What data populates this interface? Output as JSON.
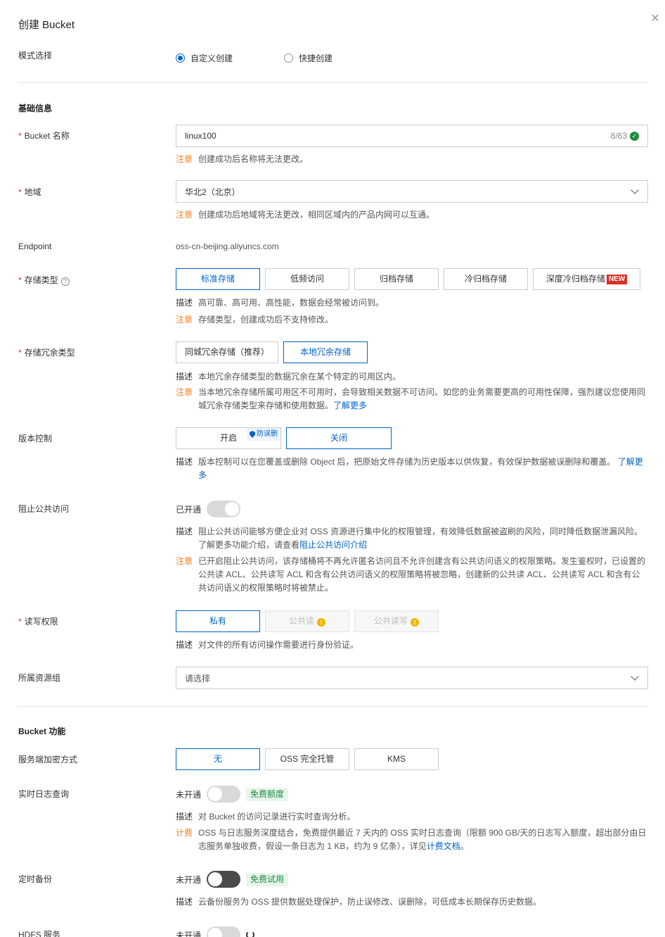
{
  "header": {
    "title": "创建 Bucket"
  },
  "mode": {
    "label": "模式选择",
    "options": [
      "自定义创建",
      "快捷创建"
    ],
    "selected": 0
  },
  "basic": {
    "section_title": "基础信息",
    "bucket_name": {
      "label": "Bucket 名称",
      "value": "linux100",
      "count": "8/63",
      "note_tag": "注意",
      "note": "创建成功后名称将无法更改。"
    },
    "region": {
      "label": "地域",
      "value": "华北2（北京）",
      "note_tag": "注意",
      "note": "创建成功后地域将无法更改，相同区域内的产品内网可以互通。"
    },
    "endpoint": {
      "label": "Endpoint",
      "value": "oss-cn-beijing.aliyuncs.com"
    },
    "storage_class": {
      "label": "存储类型",
      "options": [
        "标准存储",
        "低频访问",
        "归档存储",
        "冷归档存储",
        "深度冷归档存储"
      ],
      "new_badge": "NEW",
      "selected": 0,
      "desc_tag": "描述",
      "desc": "高可靠、高可用、高性能，数据会经常被访问到。",
      "note_tag": "注意",
      "note": "存储类型，创建成功后不支持修改。"
    },
    "redundancy": {
      "label": "存储冗余类型",
      "options": [
        "同城冗余存储（推荐）",
        "本地冗余存储"
      ],
      "selected": 1,
      "desc_tag": "描述",
      "desc": "本地冗余存储类型的数据冗余在某个特定的可用区内。",
      "note_tag": "注意",
      "note": "当本地冗余存储所属可用区不可用时，会导致相关数据不可访问。如您的业务需要更高的可用性保障，强烈建议您使用同城冗余存储类型来存储和使用数据。",
      "note_link": "了解更多"
    },
    "versioning": {
      "label": "版本控制",
      "options": [
        "开启",
        "关闭"
      ],
      "badge": "防误删",
      "selected": 1,
      "desc_tag": "描述",
      "desc": "版本控制可以在您覆盖或删除 Object 后，把原始文件存储为历史版本以供恢复，有效保护数据被误删除和覆盖。",
      "desc_link": "了解更多"
    },
    "block_public": {
      "label": "阻止公共访问",
      "status": "已开通",
      "desc_tag": "描述",
      "desc": "阻止公共访问能够方便企业对 OSS 资源进行集中化的权限管理，有效降低数据被盗刷的风险，同时降低数据泄漏风险。了解更多功能介绍，请查看",
      "desc_link": "阻止公共访问介绍",
      "note_tag": "注意",
      "note": "已开启阻止公共访问，该存储桶将不再允许匿名访问且不允许创建含有公共访问语义的权限策略。发生鉴权时，已设置的公共读 ACL、公共读写 ACL 和含有公共访问语义的权限策略将被忽略，创建新的公共读 ACL、公共读写 ACL 和含有公共访问语义的权限策略时将被禁止。"
    },
    "acl": {
      "label": "读写权限",
      "options": [
        "私有",
        "公共读",
        "公共读写"
      ],
      "selected": 0,
      "desc_tag": "描述",
      "desc": "对文件的所有访问操作需要进行身份验证。"
    },
    "resource_group": {
      "label": "所属资源组",
      "placeholder": "请选择"
    }
  },
  "features": {
    "section_title": "Bucket 功能",
    "encryption": {
      "label": "服务端加密方式",
      "options": [
        "无",
        "OSS 完全托管",
        "KMS"
      ],
      "selected": 0
    },
    "log_query": {
      "label": "实时日志查询",
      "status": "未开通",
      "badge": "免费额度",
      "desc_tag": "描述",
      "desc": "对 Bucket 的访问记录进行实时查询分析。",
      "fee_tag": "计费",
      "fee": "OSS 与日志服务深度结合，免费提供最近 7 天内的 OSS 实时日志查询（限额 900 GB/天的日志写入额度，超出部分由日志服务单独收费，假设一条日志为 1 KB，约为 9 亿条），详见",
      "fee_link": "计费文档",
      "fee_end": "。"
    },
    "backup": {
      "label": "定时备份",
      "status": "未开通",
      "badge": "免费试用",
      "desc_tag": "描述",
      "desc": "云备份服务为 OSS 提供数据处理保护，防止误修改、误删除，可低成本长期保存历史数据。"
    },
    "hdfs": {
      "label": "HDFS 服务",
      "status": "未开通"
    }
  },
  "colors": {
    "accent": "#0064c8",
    "warn": "#f5821f",
    "required": "#d93026",
    "green": "#1e8e3e"
  }
}
